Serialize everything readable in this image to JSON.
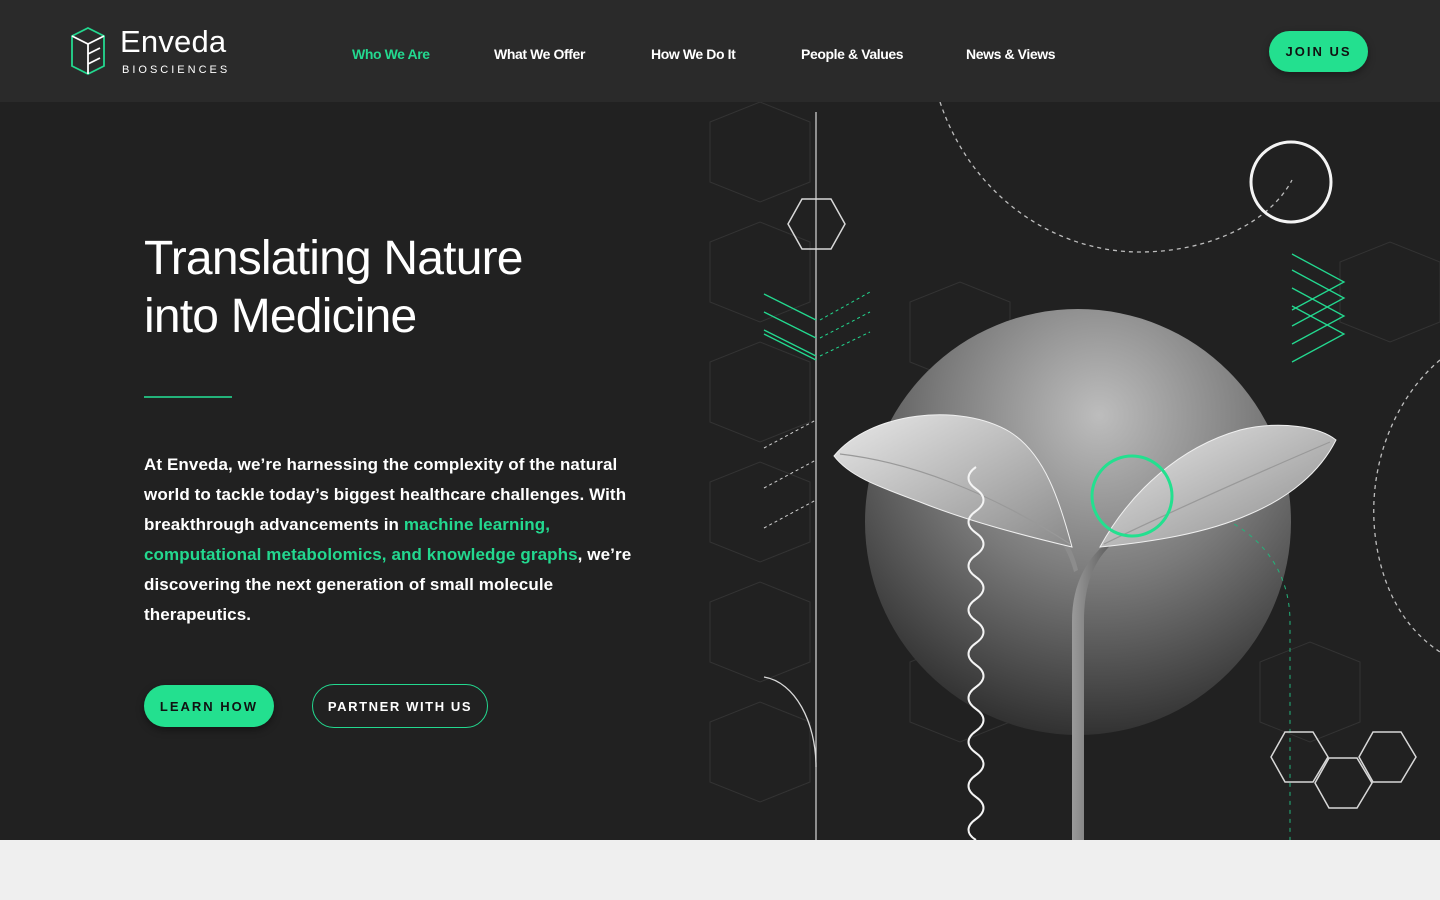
{
  "brand": {
    "name": "Enveda",
    "subtitle": "BIOSCIENCES",
    "accent": "#23e08f",
    "background": "#212121",
    "header_bg": "#2a2a2a"
  },
  "nav": {
    "items": [
      {
        "label": "Who We Are",
        "active": true
      },
      {
        "label": "What We Offer",
        "active": false
      },
      {
        "label": "How We Do It",
        "active": false
      },
      {
        "label": "People & Values",
        "active": false
      },
      {
        "label": "News & Views",
        "active": false
      }
    ],
    "cta": "JOIN US"
  },
  "hero": {
    "title_line1": "Translating Nature",
    "title_line2": "into Medicine",
    "text_before": "At Enveda, we’re harnessing the complexity of the natural world to tackle today’s biggest healthcare challenges. With breakthrough advancements in ",
    "text_highlight": "machine learning, computational metabolomics, and knowledge graphs",
    "text_after": ", we’re discovering the next generation of small molecule therapeutics.",
    "primary_button": "LEARN HOW",
    "secondary_button": "PARTNER WITH US"
  },
  "illustration": {
    "subject": "plant-seedling-sphere",
    "icons": [
      "hexagon-icon",
      "chevron-lines-icon",
      "circle-ring-icon",
      "hexagon-cluster-icon",
      "wavy-line-icon"
    ]
  }
}
